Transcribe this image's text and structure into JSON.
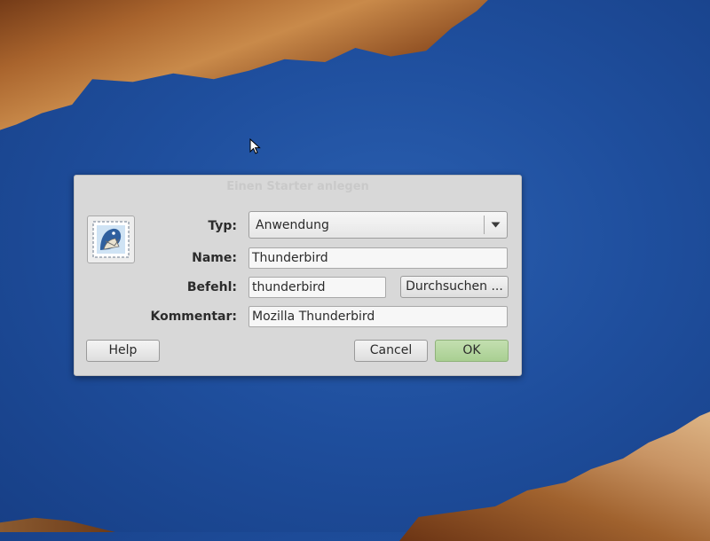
{
  "dialog": {
    "title": "Einen Starter anlegen",
    "icon": "thunderbird-stamp-icon",
    "fields": {
      "type_label": "Typ:",
      "type_value": "Anwendung",
      "name_label": "Name:",
      "name_value": "Thunderbird",
      "command_label": "Befehl:",
      "command_value": "thunderbird",
      "comment_label": "Kommentar:",
      "comment_value": "Mozilla Thunderbird"
    },
    "buttons": {
      "browse": "Durchsuchen ...",
      "help": "Help",
      "cancel": "Cancel",
      "ok": "OK"
    }
  },
  "colors": {
    "desktop_blue": "#1f4f9e",
    "dialog_bg": "#d8d8d8",
    "ok_green": "#b3d69c"
  }
}
